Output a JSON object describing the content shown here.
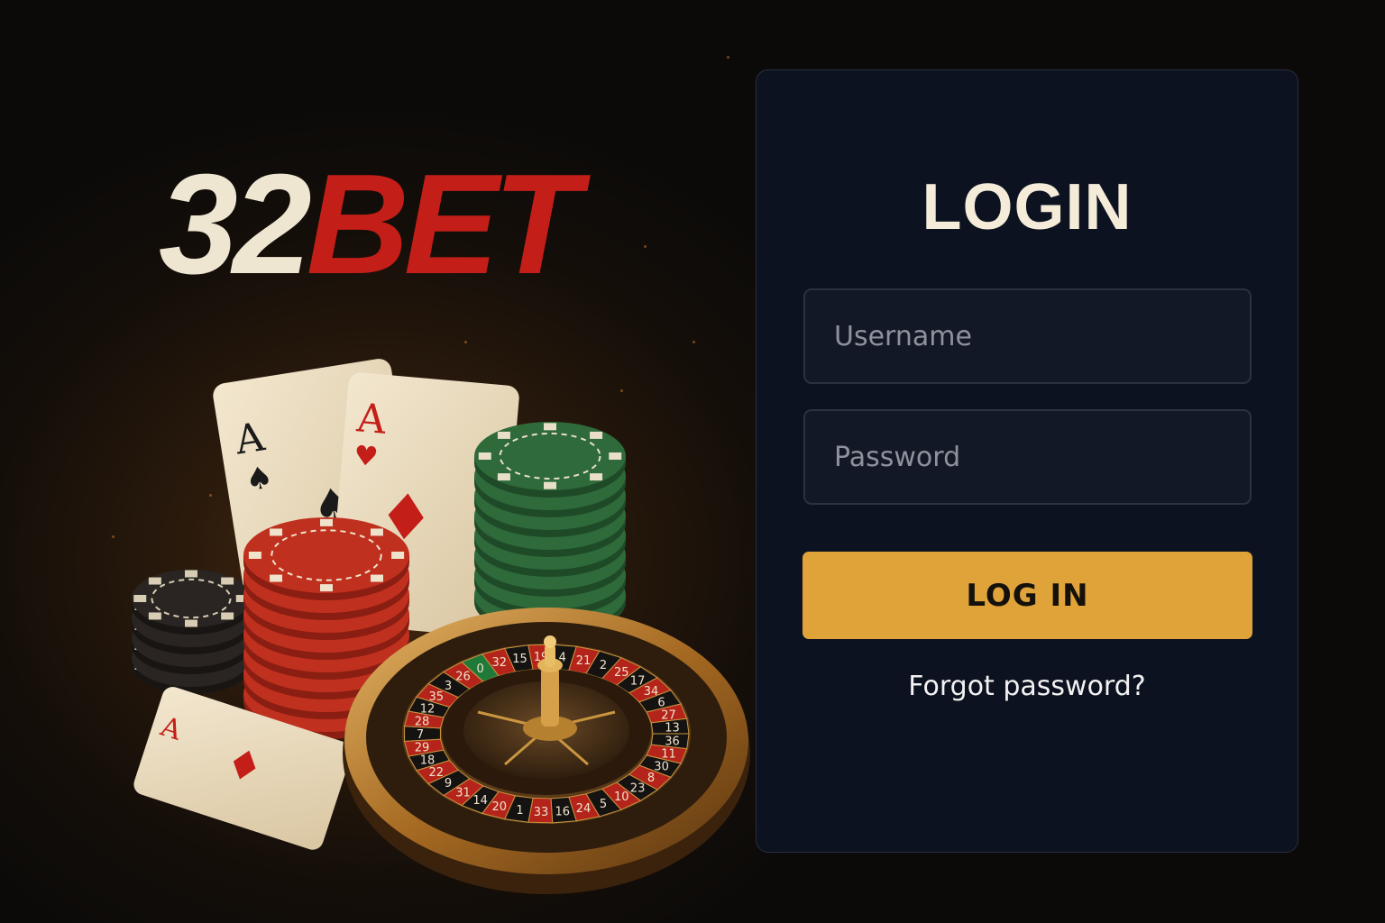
{
  "brand": {
    "logo_number": "32",
    "logo_word": "BET",
    "logo_number_color": "#efe6d2",
    "logo_word_color": "#c41e18"
  },
  "illustration": {
    "card_rank": "A",
    "roulette_numbers": [
      "36",
      "11",
      "30",
      "8",
      "23",
      "10",
      "5",
      "24",
      "16",
      "33",
      "1",
      "20",
      "14",
      "31",
      "9",
      "22",
      "18",
      "29",
      "7",
      "28",
      "12",
      "35",
      "3",
      "26",
      "0",
      "32",
      "15",
      "19",
      "4",
      "21",
      "2",
      "25",
      "17",
      "34",
      "6",
      "27",
      "13"
    ]
  },
  "login": {
    "title": "LOGIN",
    "username_placeholder": "Username",
    "password_placeholder": "Password",
    "submit_label": "LOG IN",
    "forgot_label": "Forgot password?",
    "accent_color": "#e0a33a",
    "card_color": "#0d1220"
  }
}
